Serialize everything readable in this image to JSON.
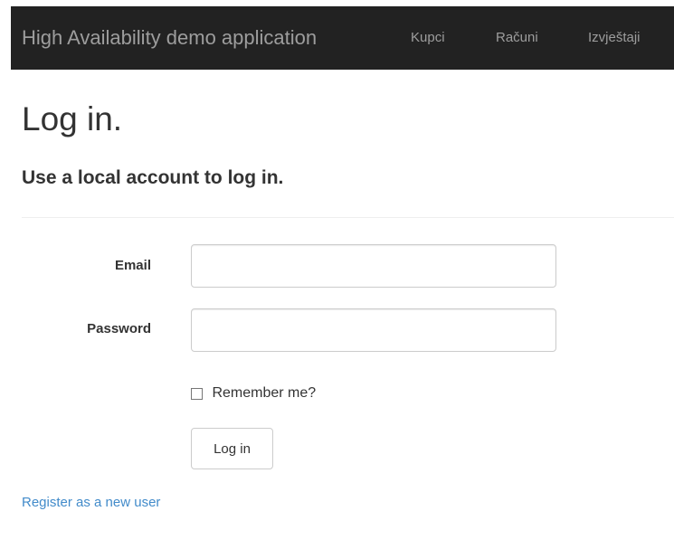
{
  "navbar": {
    "brand": "High Availability demo application",
    "items": [
      {
        "label": "Kupci"
      },
      {
        "label": "Računi"
      },
      {
        "label": "Izvještaji"
      }
    ]
  },
  "page": {
    "title": "Log in.",
    "subtitle": "Use a local account to log in."
  },
  "form": {
    "email_label": "Email",
    "email_value": "",
    "password_label": "Password",
    "password_value": "",
    "remember_label": "Remember me?",
    "remember_checked": false,
    "submit_label": "Log in"
  },
  "links": {
    "register": "Register as a new user"
  },
  "colors": {
    "navbar_bg": "#222222",
    "navbar_text": "#9d9d9d",
    "link": "#428bca",
    "text": "#333333"
  }
}
